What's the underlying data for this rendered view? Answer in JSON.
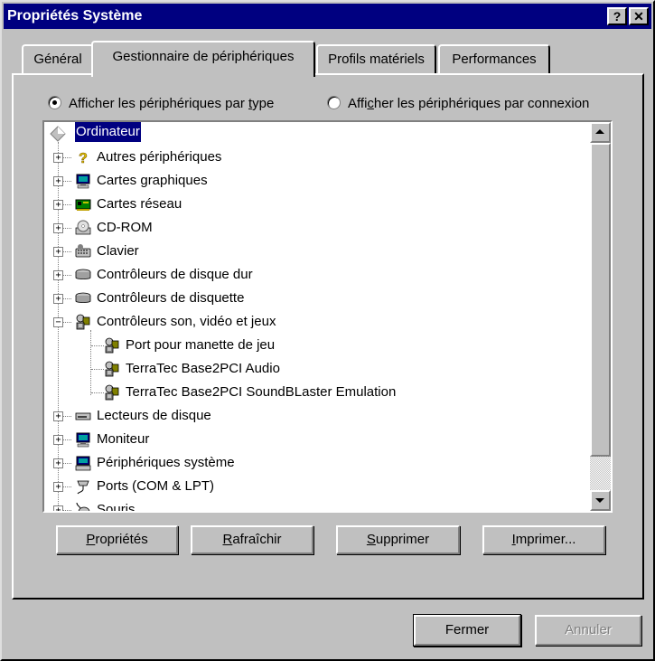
{
  "window": {
    "title": "Propriétés Système",
    "help_label": "?",
    "close_label": "✕"
  },
  "tabs": [
    {
      "label": "Général"
    },
    {
      "label": "Gestionnaire de périphériques"
    },
    {
      "label": "Profils matériels"
    },
    {
      "label": "Performances"
    }
  ],
  "view_options": {
    "by_type": {
      "pre": "Afficher les périphériques par ",
      "u": "t",
      "post": "ype",
      "selected": true
    },
    "by_connection": {
      "pre": "Affi",
      "u": "c",
      "post": "her les périphériques par connexion",
      "selected": false
    }
  },
  "tree": {
    "root": "Ordinateur",
    "items": [
      {
        "label": "Autres périphériques",
        "icon": "question-icon",
        "expander": "+"
      },
      {
        "label": "Cartes graphiques",
        "icon": "monitor-icon",
        "expander": "+"
      },
      {
        "label": "Cartes réseau",
        "icon": "network-card-icon",
        "expander": "+"
      },
      {
        "label": "CD-ROM",
        "icon": "cdrom-icon",
        "expander": "+"
      },
      {
        "label": "Clavier",
        "icon": "keyboard-icon",
        "expander": "+"
      },
      {
        "label": "Contrôleurs de disque dur",
        "icon": "hard-disk-controller-icon",
        "expander": "+"
      },
      {
        "label": "Contrôleurs de disquette",
        "icon": "floppy-controller-icon",
        "expander": "+"
      },
      {
        "label": "Contrôleurs son, vidéo et jeux",
        "icon": "multimedia-icon",
        "expander": "−"
      },
      {
        "label": "Lecteurs de disque",
        "icon": "disk-drive-icon",
        "expander": "+"
      },
      {
        "label": "Moniteur",
        "icon": "monitor-icon",
        "expander": "+"
      },
      {
        "label": "Périphériques système",
        "icon": "system-device-icon",
        "expander": "+"
      },
      {
        "label": "Ports (COM & LPT)",
        "icon": "port-icon",
        "expander": "+"
      },
      {
        "label": "Souris",
        "icon": "mouse-icon",
        "expander": "+"
      }
    ],
    "children": [
      {
        "label": "Port pour manette de jeu",
        "icon": "multimedia-icon"
      },
      {
        "label": "TerraTec Base2PCI Audio",
        "icon": "multimedia-icon"
      },
      {
        "label": "TerraTec Base2PCI SoundBLaster Emulation",
        "icon": "multimedia-icon"
      }
    ]
  },
  "actions": {
    "properties": {
      "u": "P",
      "post": "ropriétés"
    },
    "refresh": {
      "u": "R",
      "post": "afraîchir"
    },
    "remove": {
      "u": "S",
      "post": "upprimer"
    },
    "print": {
      "u": "I",
      "post": "mprimer..."
    }
  },
  "footer": {
    "close_label": "Fermer",
    "cancel_label": "Annuler"
  },
  "colors": {
    "face": "#c0c0c0",
    "titlebar": "#000080",
    "selection": "#000080"
  }
}
